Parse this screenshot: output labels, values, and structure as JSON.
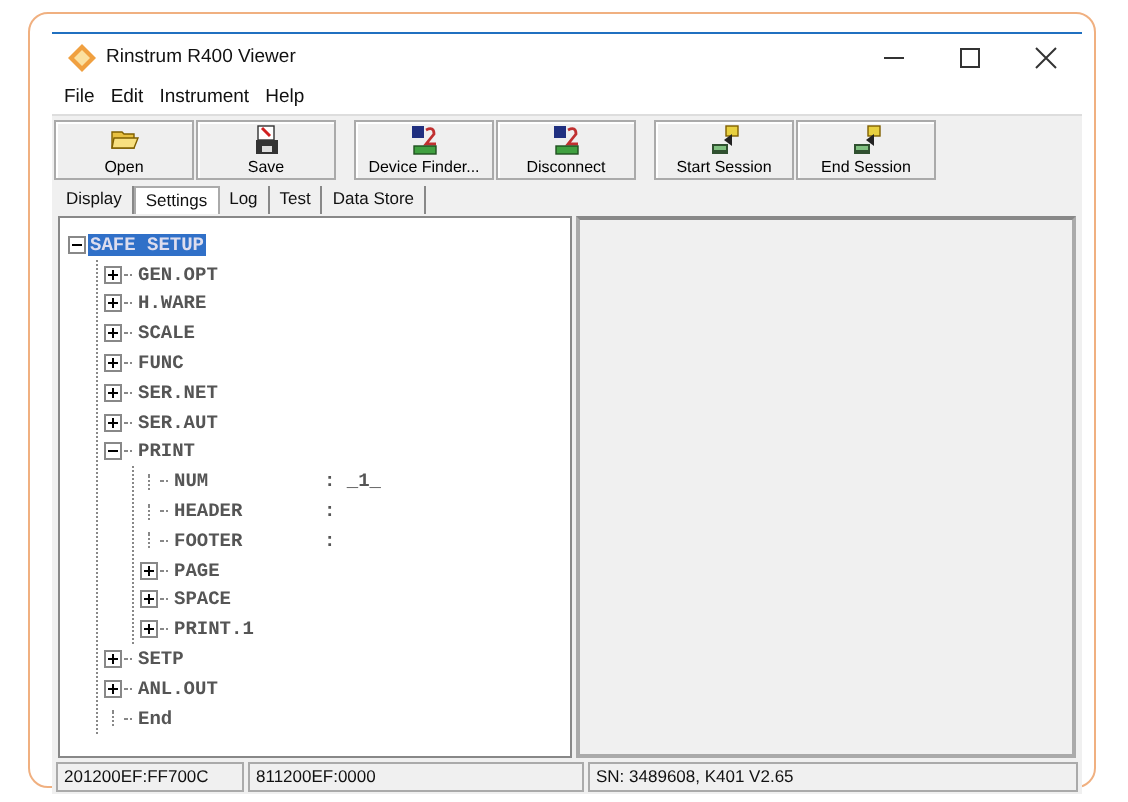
{
  "window": {
    "title": "Rinstrum R400 Viewer"
  },
  "menu": [
    "File",
    "Edit",
    "Instrument",
    "Help"
  ],
  "toolbar": [
    {
      "label": "Open",
      "kind": "open"
    },
    {
      "label": "Save",
      "kind": "save"
    },
    {
      "label": "Device Finder...",
      "kind": "device"
    },
    {
      "label": "Disconnect",
      "kind": "device"
    },
    {
      "label": "Start Session",
      "kind": "session"
    },
    {
      "label": "End Session",
      "kind": "session"
    }
  ],
  "tabs": [
    {
      "label": "Display",
      "selected": false
    },
    {
      "label": "Settings",
      "selected": true
    },
    {
      "label": "Log",
      "selected": false
    },
    {
      "label": "Test",
      "selected": false
    },
    {
      "label": "Data Store",
      "selected": false
    }
  ],
  "tree": [
    {
      "label": "SAFE SETUP",
      "selected": true,
      "expanded": true,
      "children": [
        {
          "label": "GEN.OPT",
          "selected": false,
          "expanded": false
        },
        {
          "label": "H.WARE",
          "selected": false,
          "expanded": false
        },
        {
          "label": "SCALE",
          "selected": false,
          "expanded": false
        },
        {
          "label": "FUNC",
          "selected": false,
          "expanded": false
        },
        {
          "label": "SER.NET",
          "selected": false,
          "expanded": false
        },
        {
          "label": "SER.AUT",
          "selected": false,
          "expanded": false
        },
        {
          "label": "PRINT",
          "selected": false,
          "expanded": true,
          "children": [
            {
              "label": "NUM",
              "value": ": _1_",
              "selected": false
            },
            {
              "label": "HEADER",
              "value": ":",
              "selected": false
            },
            {
              "label": "FOOTER",
              "value": ":",
              "selected": false
            },
            {
              "label": "PAGE",
              "selected": false,
              "expanded": false
            },
            {
              "label": "SPACE",
              "selected": false,
              "expanded": false
            },
            {
              "label": "PRINT.1",
              "selected": false,
              "expanded": false
            }
          ]
        },
        {
          "label": "SETP",
          "selected": false,
          "expanded": false
        },
        {
          "label": "ANL.OUT",
          "selected": false,
          "expanded": false
        },
        {
          "label": "End",
          "selected": false
        }
      ]
    }
  ],
  "status_bar": [
    "201200EF:FF700C",
    "811200EF:0000",
    "SN: 3489608, K401 V2.65"
  ]
}
